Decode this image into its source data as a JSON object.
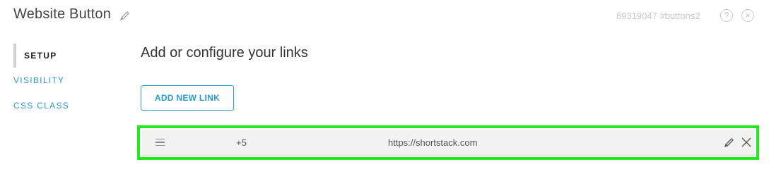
{
  "header": {
    "title": "Website Button",
    "meta": "89319047 #buttons2",
    "help_glyph": "?",
    "close_glyph": "×"
  },
  "sidebar": {
    "items": [
      {
        "label": "SETUP",
        "active": true
      },
      {
        "label": "VISIBILITY",
        "active": false
      },
      {
        "label": "CSS CLASS",
        "active": false
      }
    ]
  },
  "main": {
    "title": "Add or configure your links",
    "add_button_label": "ADD NEW LINK",
    "links": [
      {
        "count": "+5",
        "url": "https://shortstack.com"
      }
    ]
  },
  "colors": {
    "accent": "#2b9bc6",
    "highlight": "#22e81e",
    "row_background": "#f2f2f2"
  },
  "icons": [
    "pencil-icon",
    "help-icon",
    "close-icon",
    "drag-handle-icon",
    "x-icon"
  ]
}
